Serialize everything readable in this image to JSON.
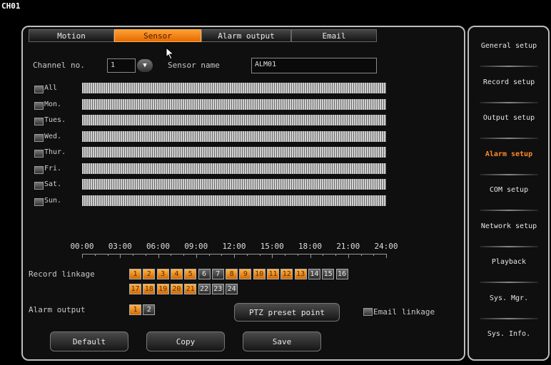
{
  "window": {
    "title": "CH01"
  },
  "tabs": [
    {
      "label": "Motion",
      "active": false
    },
    {
      "label": "Sensor",
      "active": true
    },
    {
      "label": "Alarm output",
      "active": false
    },
    {
      "label": "Email",
      "active": false
    }
  ],
  "sensor": {
    "channel_label": "Channel no.",
    "channel_value": "1",
    "sensor_name_label": "Sensor name",
    "sensor_name_value": "ALM01"
  },
  "schedule": {
    "days": [
      "All",
      "Mon.",
      "Tues.",
      "Wed.",
      "Thur.",
      "Fri.",
      "Sat.",
      "Sun."
    ],
    "time_labels": [
      "00:00",
      "03:00",
      "06:00",
      "09:00",
      "12:00",
      "15:00",
      "18:00",
      "21:00",
      "24:00"
    ]
  },
  "record_linkage": {
    "label": "Record linkage",
    "channels": [
      "1",
      "2",
      "3",
      "4",
      "5",
      "6",
      "7",
      "8",
      "9",
      "10",
      "11",
      "12",
      "13",
      "14",
      "15",
      "16",
      "17",
      "18",
      "19",
      "20",
      "21",
      "22",
      "23",
      "24"
    ],
    "selected": [
      "1",
      "2",
      "3",
      "4",
      "5",
      "8",
      "9",
      "10",
      "11",
      "12",
      "13",
      "17",
      "18",
      "19",
      "20",
      "21"
    ]
  },
  "alarm_output": {
    "label": "Alarm output",
    "channels": [
      "1",
      "2"
    ],
    "selected": [
      "1"
    ]
  },
  "ptz_button": "PTZ preset point",
  "email_linkage_label": "Email linkage",
  "buttons": {
    "default": "Default",
    "copy": "Copy",
    "save": "Save"
  },
  "side_menu": [
    {
      "label": "General setup",
      "active": false
    },
    {
      "label": "Record setup",
      "active": false
    },
    {
      "label": "Output setup",
      "active": false
    },
    {
      "label": "Alarm setup",
      "active": true
    },
    {
      "label": "COM setup",
      "active": false
    },
    {
      "label": "Network setup",
      "active": false
    },
    {
      "label": "Playback",
      "active": false
    },
    {
      "label": "Sys. Mgr.",
      "active": false
    },
    {
      "label": "Sys. Info.",
      "active": false
    }
  ],
  "colors": {
    "accent": "#f07d10",
    "active_menu": "#ff8a2a",
    "background": "#000000"
  }
}
